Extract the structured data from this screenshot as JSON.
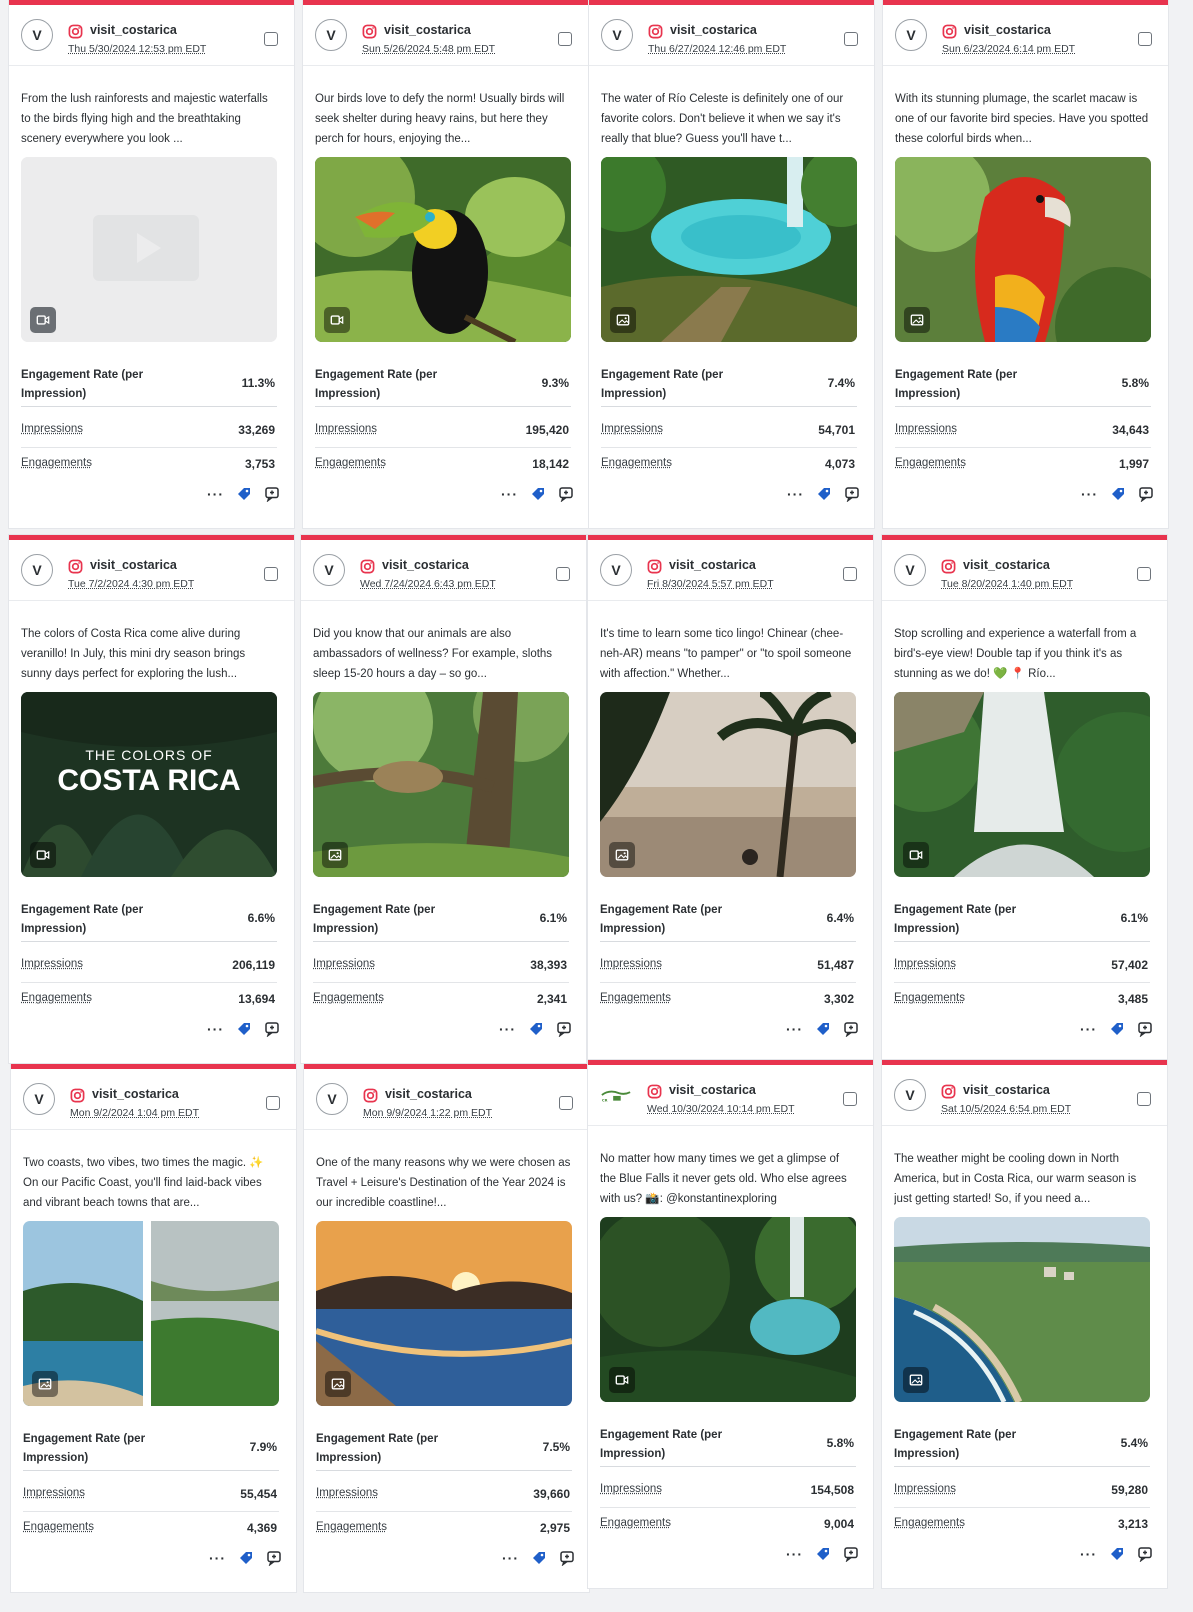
{
  "accent_color": "#e8344e",
  "tag_color": "#1f5fc9",
  "posts": [
    {
      "avatar": "V",
      "username": "visit_costarica",
      "date": "Thu 5/30/2024 12:53 pm EDT",
      "caption": "From the lush rainforests and majestic waterfalls to the birds flying high and the breathtaking scenery everywhere you look ...",
      "media_type": "video",
      "scene": "placeholder",
      "rate_label": "Engagement Rate (per Impression)",
      "rate": "11.3%",
      "impressions_label": "Impressions",
      "impressions": "33,269",
      "engagements_label": "Engagements",
      "engagements": "3,753"
    },
    {
      "avatar": "V",
      "username": "visit_costarica",
      "date": "Sun 5/26/2024 5:48 pm EDT",
      "caption": "Our birds love to defy the norm! Usually birds will seek shelter during heavy rains, but here they perch for hours, enjoying the...",
      "media_type": "video",
      "scene": "toucan",
      "rate_label": "Engagement Rate (per Impression)",
      "rate": "9.3%",
      "impressions_label": "Impressions",
      "impressions": "195,420",
      "engagements_label": "Engagements",
      "engagements": "18,142"
    },
    {
      "avatar": "V",
      "username": "visit_costarica",
      "date": "Thu 6/27/2024 12:46 pm EDT",
      "caption": "The water of Río Celeste is definitely one of our favorite colors. Don't believe it when we say it's really that blue? Guess you'll have t...",
      "media_type": "image",
      "scene": "river",
      "rate_label": "Engagement Rate (per Impression)",
      "rate": "7.4%",
      "impressions_label": "Impressions",
      "impressions": "54,701",
      "engagements_label": "Engagements",
      "engagements": "4,073"
    },
    {
      "avatar": "V",
      "username": "visit_costarica",
      "date": "Sun 6/23/2024 6:14 pm EDT",
      "caption": "With its stunning plumage, the scarlet macaw is one of our favorite bird species. Have you spotted these colorful birds when...",
      "media_type": "image",
      "scene": "macaw",
      "rate_label": "Engagement Rate (per Impression)",
      "rate": "5.8%",
      "impressions_label": "Impressions",
      "impressions": "34,643",
      "engagements_label": "Engagements",
      "engagements": "1,997"
    },
    {
      "avatar": "V",
      "username": "visit_costarica",
      "date": "Tue 7/2/2024 4:30 pm EDT",
      "caption": "The colors of Costa Rica come alive during veranillo! In July, this mini dry season brings sunny days perfect for exploring the lush...",
      "media_type": "video",
      "scene": "colors",
      "overlay_small": "THE COLORS OF",
      "overlay_big": "COSTA RICA",
      "rate_label": "Engagement Rate (per Impression)",
      "rate": "6.6%",
      "impressions_label": "Impressions",
      "impressions": "206,119",
      "engagements_label": "Engagements",
      "engagements": "13,694"
    },
    {
      "avatar": "V",
      "username": "visit_costarica",
      "date": "Wed 7/24/2024 6:43 pm EDT",
      "caption": "Did you know that our animals are also ambassadors of wellness? For example, sloths sleep 15-20 hours a day – so go...",
      "media_type": "image",
      "scene": "sloth",
      "rate_label": "Engagement Rate (per Impression)",
      "rate": "6.1%",
      "impressions_label": "Impressions",
      "impressions": "38,393",
      "engagements_label": "Engagements",
      "engagements": "2,341"
    },
    {
      "avatar": "V",
      "username": "visit_costarica",
      "date": "Fri 8/30/2024 5:57 pm EDT",
      "caption": "It's time to learn some tico lingo! Chinear (chee-neh-AR) means \"to pamper\" or \"to spoil someone with affection.\" Whether...",
      "media_type": "image",
      "scene": "palm",
      "rate_label": "Engagement Rate (per Impression)",
      "rate": "6.4%",
      "impressions_label": "Impressions",
      "impressions": "51,487",
      "engagements_label": "Engagements",
      "engagements": "3,302"
    },
    {
      "avatar": "V",
      "username": "visit_costarica",
      "date": "Tue 8/20/2024 1:40 pm EDT",
      "caption": "Stop scrolling and experience a waterfall from a bird's-eye view! Double tap if you think it's as stunning as we do! 💚 📍 Río...",
      "media_type": "video",
      "scene": "falls",
      "rate_label": "Engagement Rate (per Impression)",
      "rate": "6.1%",
      "impressions_label": "Impressions",
      "impressions": "57,402",
      "engagements_label": "Engagements",
      "engagements": "3,485"
    },
    {
      "avatar": "V",
      "username": "visit_costarica",
      "date": "Mon 9/2/2024 1:04 pm EDT",
      "caption": "Two coasts, two vibes, two times the magic. ✨ On our Pacific Coast, you'll find laid-back vibes and vibrant beach towns that are...",
      "media_type": "image",
      "scene": "coasts",
      "rate_label": "Engagement Rate (per Impression)",
      "rate": "7.9%",
      "impressions_label": "Impressions",
      "impressions": "55,454",
      "engagements_label": "Engagements",
      "engagements": "4,369"
    },
    {
      "avatar": "V",
      "username": "visit_costarica",
      "date": "Mon 9/9/2024 1:22 pm EDT",
      "caption": "One of the many reasons why we were chosen as Travel + Leisure's Destination of the Year 2024 is our incredible coastline!...",
      "media_type": "image",
      "scene": "sunset",
      "rate_label": "Engagement Rate (per Impression)",
      "rate": "7.5%",
      "impressions_label": "Impressions",
      "impressions": "39,660",
      "engagements_label": "Engagements",
      "engagements": "2,975"
    },
    {
      "avatar": "logo",
      "username": "visit_costarica",
      "date": "Wed 10/30/2024 10:14 pm EDT",
      "caption": "No matter how many times we get a glimpse of the Blue Falls it never gets old. Who else agrees with us? 📸: @konstantinexploring",
      "media_type": "video",
      "scene": "bluefalls",
      "rate_label": "Engagement Rate (per Impression)",
      "rate": "5.8%",
      "impressions_label": "Impressions",
      "impressions": "154,508",
      "engagements_label": "Engagements",
      "engagements": "9,004"
    },
    {
      "avatar": "V",
      "username": "visit_costarica",
      "date": "Sat 10/5/2024 6:54 pm EDT",
      "caption": "The weather might be cooling down in North America, but in Costa Rica, our warm season is just getting started! So, if you need a...",
      "media_type": "image",
      "scene": "beachtown",
      "rate_label": "Engagement Rate (per Impression)",
      "rate": "5.4%",
      "impressions_label": "Impressions",
      "impressions": "59,280",
      "engagements_label": "Engagements",
      "engagements": "3,213"
    }
  ]
}
